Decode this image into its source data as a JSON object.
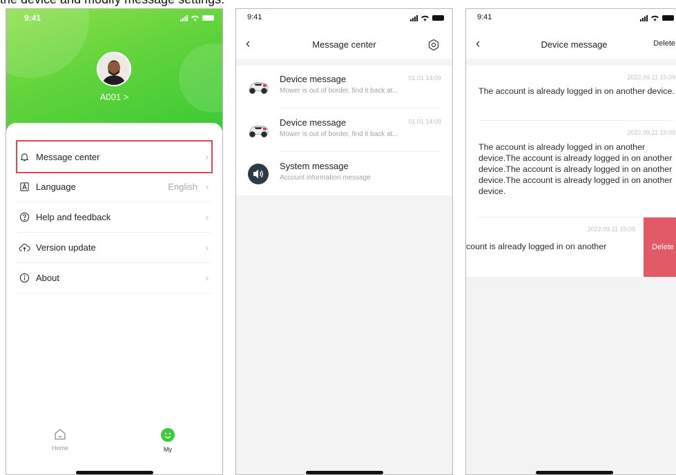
{
  "caption": "the device and modify message settings.",
  "colors": {
    "accent_green": "#36c834",
    "highlight_red": "#d94a55",
    "delete_red": "#e25a65"
  },
  "icons": [
    "bell-icon",
    "language-icon",
    "help-icon",
    "cloud-upload-icon",
    "info-icon",
    "home-icon",
    "smiley-icon",
    "back-chevron-icon",
    "settings-gear-icon",
    "mower-icon",
    "speaker-icon",
    "signal-icon",
    "wifi-icon",
    "battery-icon"
  ],
  "profile_screen": {
    "time": "9:41",
    "username": "A001",
    "username_arrow": ">",
    "menu": [
      {
        "label": "Message center",
        "value": "",
        "icon": "bell-icon"
      },
      {
        "label": "Language",
        "value": "English",
        "icon": "language-icon"
      },
      {
        "label": "Help and feedback",
        "value": "",
        "icon": "help-icon"
      },
      {
        "label": "Version update",
        "value": "",
        "icon": "cloud-upload-icon"
      },
      {
        "label": "About",
        "value": "",
        "icon": "info-icon"
      }
    ],
    "tabs": [
      {
        "label": "Home",
        "icon": "home-icon"
      },
      {
        "label": "My",
        "icon": "smiley-icon",
        "active": true
      }
    ]
  },
  "message_center_screen": {
    "time": "9:41",
    "title": "Message center",
    "messages": [
      {
        "title": "Device message",
        "desc": "Mower is out of border, find it back at...",
        "time": "01.01 14:09",
        "icon": "mower-icon"
      },
      {
        "title": "Device message",
        "desc": "Mower is out of border, find it back at...",
        "time": "01.01 14:09",
        "icon": "mower-icon"
      },
      {
        "title": "System message",
        "desc": "Account information message",
        "time": "",
        "icon": "speaker-icon"
      }
    ]
  },
  "device_message_screen": {
    "time": "9:41",
    "title": "Device message",
    "delete_label": "Delete",
    "messages": [
      {
        "time": "2022.09.11  15:09",
        "text": "The account is already logged in on another device."
      },
      {
        "time": "2022.09.11  15:09",
        "text": "The account is already logged in on another device.The account is already logged in on another device.The account is already logged in on another device.The account is already logged in on another device."
      },
      {
        "time": "2022.09.11  15:09",
        "text": "count is already logged in on another"
      }
    ],
    "swipe_delete_label": "Delete"
  }
}
